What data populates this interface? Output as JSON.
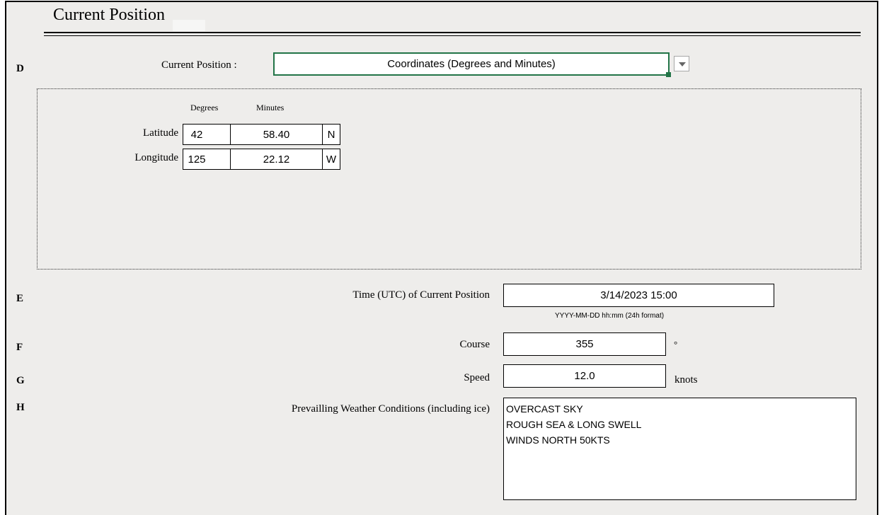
{
  "section_title": "Current Position",
  "rows": {
    "d": {
      "letter": "D",
      "label": "Current Position :",
      "dropdown_value": "Coordinates (Degrees and Minutes)"
    },
    "e": {
      "letter": "E",
      "label": "Time (UTC) of Current Position",
      "value": "3/14/2023 15:00",
      "hint": "YYYY-MM-DD hh:mm (24h format)"
    },
    "f": {
      "letter": "F",
      "label": "Course",
      "value": "355",
      "unit": "°"
    },
    "g": {
      "letter": "G",
      "label": "Speed",
      "value": "12.0",
      "unit": "knots"
    },
    "h": {
      "letter": "H",
      "label": "Prevailling Weather Conditions (including ice)",
      "lines": [
        "OVERCAST SKY",
        "ROUGH SEA & LONG SWELL",
        "WINDS NORTH 50KTS"
      ]
    }
  },
  "coordinates": {
    "degrees_header": "Degrees",
    "minutes_header": "Minutes",
    "latitude": {
      "label": "Latitude",
      "degrees": "42",
      "minutes": "58.40",
      "hemisphere": "N"
    },
    "longitude": {
      "label": "Longitude",
      "degrees": "125",
      "minutes": "22.12",
      "hemisphere": "W"
    }
  },
  "colors": {
    "sheet_bg": "#eeedeb",
    "selection_green": "#227447"
  }
}
